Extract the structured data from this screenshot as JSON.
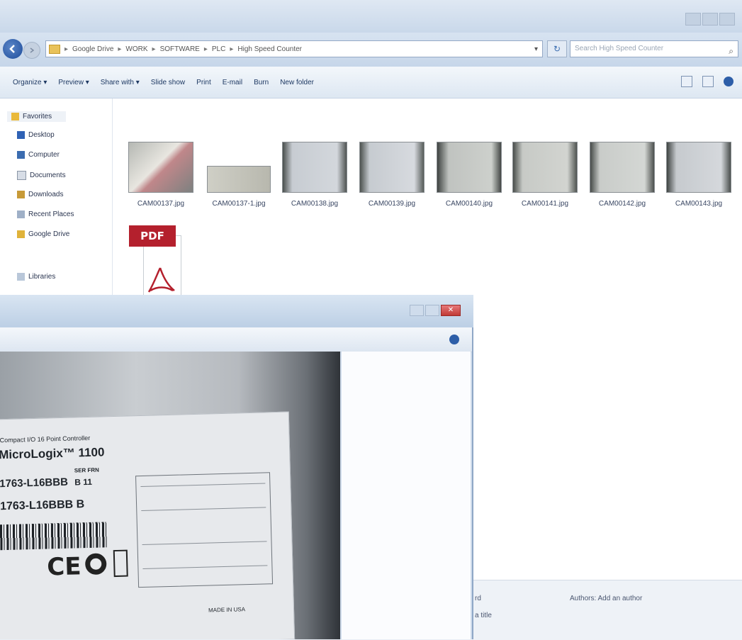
{
  "explorer": {
    "address": {
      "segments": [
        "Google Drive",
        "WORK",
        "SOFTWARE",
        "PLC",
        "High Speed Counter"
      ]
    },
    "search_placeholder": "Search High Speed Counter",
    "toolbar": [
      "Organize ▾",
      "Preview ▾",
      "Share with ▾",
      "Slide show",
      "Print",
      "E-mail",
      "Burn",
      "New folder"
    ],
    "sidebar": [
      {
        "label": "Favorites",
        "icon": "star-icon"
      },
      {
        "label": "Desktop",
        "icon": "desktop-icon"
      },
      {
        "label": "Computer",
        "icon": "computer-icon"
      },
      {
        "label": "Documents",
        "icon": "documents-icon"
      },
      {
        "label": "Downloads",
        "icon": "downloads-icon"
      },
      {
        "label": "Recent Places",
        "icon": "recent-places-icon"
      },
      {
        "label": "Google Drive",
        "icon": "google-drive-icon"
      },
      {
        "label": "Libraries",
        "icon": "libraries-icon"
      }
    ],
    "files": [
      {
        "name": "CAM00137.jpg"
      },
      {
        "name": "CAM00137-1.jpg"
      },
      {
        "name": "CAM00138.jpg"
      },
      {
        "name": "CAM00139.jpg"
      },
      {
        "name": "CAM00140.jpg"
      },
      {
        "name": "CAM00141.jpg"
      },
      {
        "name": "CAM00142.jpg"
      },
      {
        "name": "CAM00143.jpg"
      }
    ],
    "pdf_badge": "PDF",
    "details": {
      "line1": "rd",
      "line2": "a title",
      "authors": "Authors: Add an author"
    },
    "colors": {
      "pdf": "#b4202d",
      "accent": "#2d5ea8"
    }
  },
  "viewer": {
    "label": {
      "line1": "Compact I/O 16 Point Controller",
      "line2": "MicroLogix™ 1100",
      "cat": "1763-L16BBB",
      "ser_hdr": "SER   FRN",
      "ser_val": "B      11",
      "id": "1763-L16BBB B",
      "ce": "CE",
      "bottom_right": "MADE IN USA"
    }
  }
}
